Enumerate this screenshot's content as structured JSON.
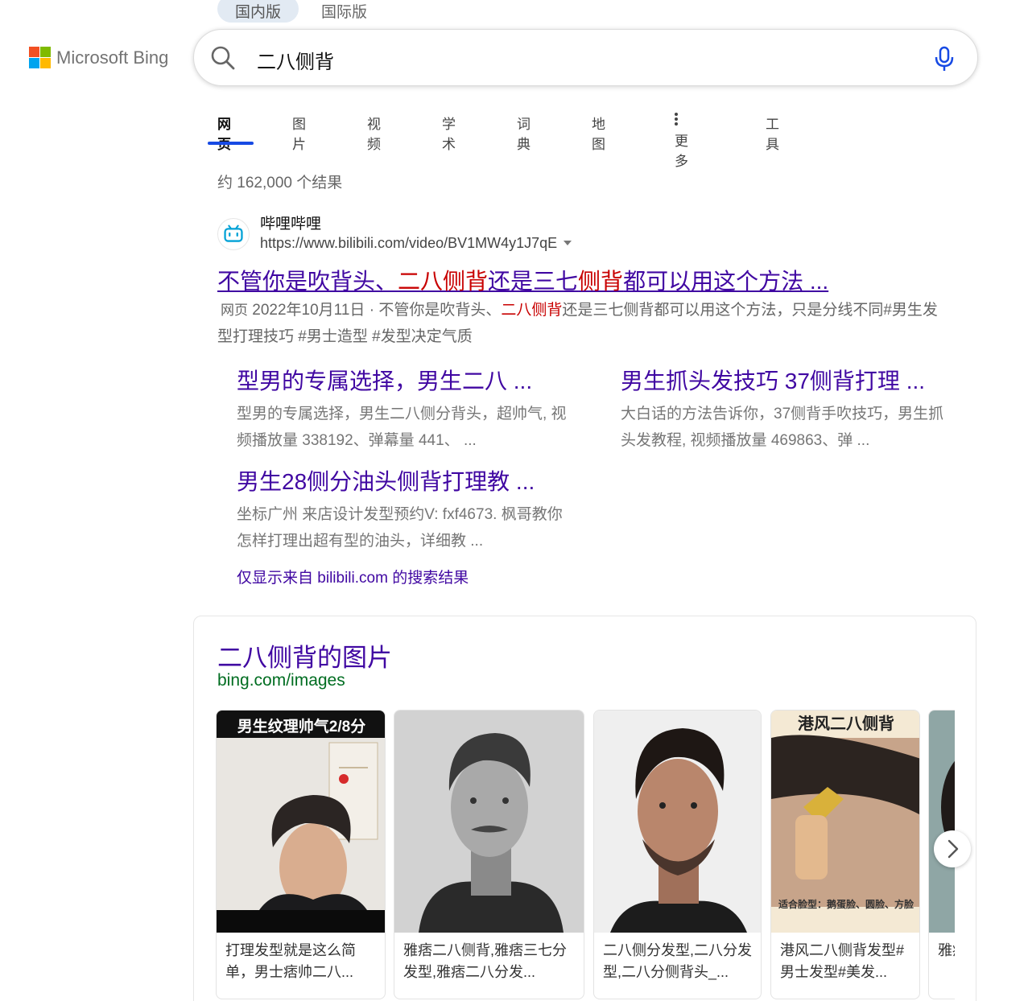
{
  "region": {
    "domestic": "国内版",
    "international": "国际版"
  },
  "brand": {
    "name": "Microsoft Bing",
    "logo_colors": [
      "#f25022",
      "#7fba00",
      "#00a4ef",
      "#ffb900"
    ]
  },
  "search": {
    "query": "二八侧背",
    "accent": "#174ae4"
  },
  "tabs": [
    {
      "label": "网页",
      "active": true
    },
    {
      "label": "图片"
    },
    {
      "label": "视频"
    },
    {
      "label": "学术"
    },
    {
      "label": "词典"
    },
    {
      "label": "地图"
    },
    {
      "label": "更多",
      "icon": "more-vertical-icon"
    },
    {
      "label": "工具"
    }
  ],
  "result_count": "约 162,000 个结果",
  "result": {
    "site_name": "哔哩哔哩",
    "url": "https://www.bilibili.com/video/BV1MW4y1J7qE",
    "title_parts": [
      "不管你是吹背头、",
      "二八侧背",
      "还是三七",
      "侧背",
      "都可以用这个方法 ..."
    ],
    "snippet_tag": "网页",
    "snippet_date": "2022年10月11日",
    "snippet_sep": "·",
    "snippet_parts": [
      "不管你是吹背头、",
      "二八侧背",
      "还是三七侧背都可以用这个方法，只是分线不同#男生发型打理技巧 #男士造型 #发型决定气质"
    ],
    "deep_links": [
      {
        "title": "型男的专属选择，男生二八 ...",
        "desc": "型男的专属选择，男生二八侧分背头，超帅气, 视频播放量 338192、弹幕量 441、 ..."
      },
      {
        "title": "男生抓头发技巧 37侧背打理 ...",
        "desc": "大白话的方法告诉你，37侧背手吹技巧，男生抓头发教程, 视频播放量 469863、弹 ..."
      },
      {
        "title": "男生28侧分油头侧背打理教 ...",
        "desc": "坐标广州 来店设计发型预约V: fxf4673. 枫哥教你怎样打理出超有型的油头，详细教 ..."
      }
    ],
    "only_from": "仅显示来自 bilibili.com 的搜索结果"
  },
  "images": {
    "title": "二八侧背的图片",
    "source": "bing.com/images",
    "items": [
      {
        "overlay": "男生纹理帅气2/8分",
        "caption": "打理发型就是这么简单，男士痞帅二八..."
      },
      {
        "overlay": "",
        "caption": "雅痞二八侧背,雅痞三七分发型,雅痞二八分发..."
      },
      {
        "overlay": "",
        "caption": "二八侧分发型,二八分发型,二八分侧背头_..."
      },
      {
        "overlay": "港风二八侧背",
        "overlay2": "适合脸型：鹅蛋脸、圆脸、方脸",
        "caption": "港风二八侧背发型#男士发型#美发..."
      },
      {
        "overlay": "",
        "caption": "雅痞分"
      }
    ],
    "next_icon": "chevron-right-icon"
  }
}
